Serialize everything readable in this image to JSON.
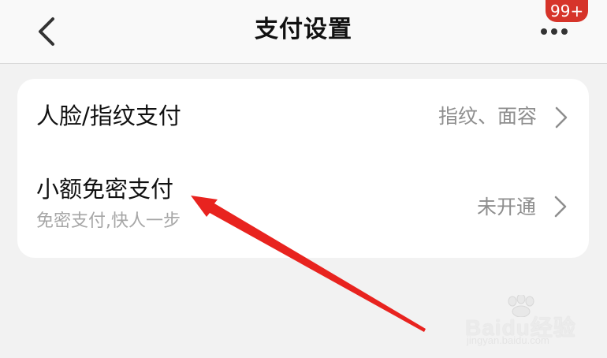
{
  "header": {
    "title": "支付设置",
    "more_badge": "99+"
  },
  "settings": {
    "items": [
      {
        "title": "人脸/指纹支付",
        "subtitle": "",
        "value": "指纹、面容"
      },
      {
        "title": "小额免密支付",
        "subtitle": "免密支付,快人一步",
        "value": "未开通"
      }
    ]
  },
  "annotation": {
    "color": "#e8231f"
  },
  "watermark": {
    "brand": "Baidu经验",
    "url": "jingyan.baidu.com"
  },
  "icons": {
    "back": "chevron-left-icon",
    "more": "more-dots-icon",
    "row_arrow": "chevron-right-icon",
    "watermark": "paw-icon"
  }
}
